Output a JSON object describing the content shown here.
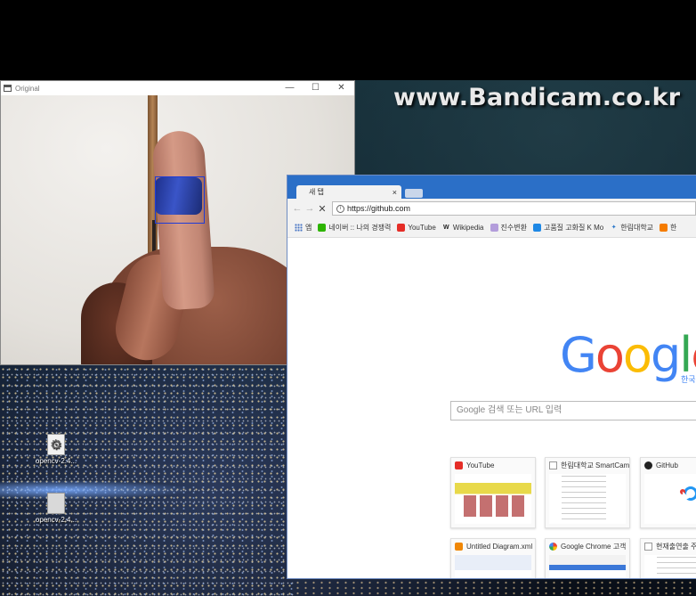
{
  "watermark": "www.Bandicam.co.kr",
  "desktop": {
    "icons": [
      {
        "label": "opencv-2.4..."
      },
      {
        "label": "opencv-2.4..."
      }
    ]
  },
  "cv_window": {
    "title": "Original",
    "controls": {
      "minimize": "—",
      "maximize": "☐",
      "close": "✕"
    }
  },
  "chrome": {
    "tab": {
      "title": "새 탭",
      "close": "×"
    },
    "nav": {
      "back": "←",
      "forward": "→",
      "stop": "✕"
    },
    "address": "https://github.com",
    "bookmarks": [
      {
        "label": "앱",
        "icon": "apps-icon"
      },
      {
        "label": "네이버 :: 나의 경쟁력",
        "icon": "naver-icon"
      },
      {
        "label": "YouTube",
        "icon": "youtube-icon"
      },
      {
        "label": "Wikipedia",
        "icon": "wikipedia-icon"
      },
      {
        "label": "진수변환",
        "icon": "bookmark-icon"
      },
      {
        "label": "고품질 고화질 K Mo",
        "icon": "go-icon"
      },
      {
        "label": "한림대학교",
        "icon": "hallym-icon"
      },
      {
        "label": "한",
        "icon": "bookmark-icon"
      }
    ],
    "google": {
      "letters": [
        "G",
        "o",
        "o",
        "g",
        "l",
        "e"
      ],
      "sub": "한국"
    },
    "search_placeholder": "Google 검색 또는 URL 입력",
    "tiles": [
      {
        "title": "YouTube"
      },
      {
        "title": "한림대학교 SmartCam"
      },
      {
        "title": "GitHub"
      },
      {
        "title": "Untitled Diagram.xml"
      },
      {
        "title": "Google Chrome 고객"
      },
      {
        "title": "현재출연출 주"
      }
    ]
  },
  "colors": {
    "chrome_frame": "#2b6fc7",
    "marker_blue": "#3a55c8",
    "bbox_blue": "#1f3bd6",
    "google_blue": "#4285f4",
    "google_red": "#ea4335",
    "google_yellow": "#fbbc05",
    "google_green": "#34a853"
  }
}
